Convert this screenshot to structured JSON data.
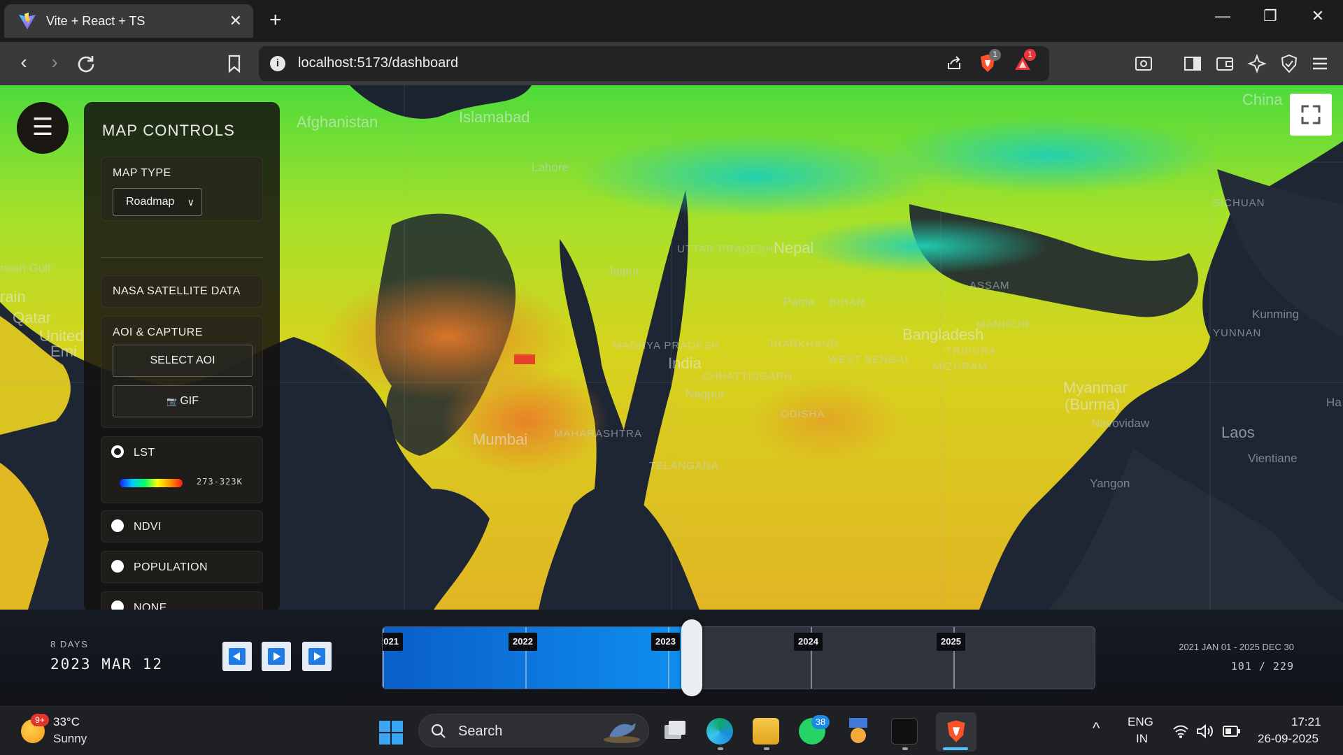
{
  "browser": {
    "tab_title": "Vite + React + TS",
    "close_glyph": "✕",
    "new_tab_glyph": "+",
    "url": "localhost:5173/dashboard",
    "shield_badge": "1",
    "rewards_badge": "1",
    "window": {
      "minimize": "—",
      "restore": "❐",
      "close": "✕"
    }
  },
  "map": {
    "place_labels": [
      "Islamabad",
      "Afghanistan",
      "Lahore",
      "Jaipur",
      "Nepal",
      "Patna",
      "Bangladesh",
      "India",
      "Nagpur",
      "Mumbai",
      "Myanmar",
      "(Burma)",
      "Navovidaw",
      "Yangon",
      "Laos",
      "Vientiane",
      "Kunming",
      "SICHUAN",
      "YUNNAN",
      "China",
      "rsian Gulf",
      "Qatar",
      "United",
      "Emi",
      "rain",
      "Ha",
      "UTTAR PRADESH",
      "MADHYA PRADESH",
      "BIHAR",
      "ASSAM",
      "MAHARASHTRA",
      "TELANGANA",
      "ODISHA",
      "WEST BENGAL",
      "JHARKHAND",
      "CHHATTISGARH",
      "TRIPURA",
      "MIZORAM",
      "MANIPUR"
    ],
    "menu_glyph": "☰"
  },
  "controls": {
    "title": "MAP CONTROLS",
    "map_type_label": "MAP TYPE",
    "map_type_value": "Roadmap",
    "nasa_label": "NASA SATELLITE DATA",
    "aoi_label": "AOI & CAPTURE",
    "select_aoi": "SELECT AOI",
    "gif_label": "GIF",
    "gif_icon": "📷",
    "layers": [
      {
        "label": "LST",
        "checked": true
      },
      {
        "label": "NDVI",
        "checked": false
      },
      {
        "label": "POPULATION",
        "checked": false
      },
      {
        "label": "NONE",
        "checked": false
      }
    ],
    "lst_range": "273-323K"
  },
  "timeline": {
    "interval": "8 DAYS",
    "current_date": "2023 MAR 12",
    "years": [
      "2021",
      "2022",
      "2023",
      "2024",
      "2025"
    ],
    "range": "2021 JAN 01 - 2025 DEC 30",
    "position": "101 / 229",
    "frame_index": 101,
    "frame_total": 229
  },
  "taskbar": {
    "weather_badge": "9+",
    "temperature": "33°C",
    "condition": "Sunny",
    "search_label": "Search",
    "whatsapp_badge": "38",
    "lang_top": "ENG",
    "lang_bottom": "IN",
    "time": "17:21",
    "date": "26-09-2025",
    "chevron": "^"
  },
  "colors": {
    "accent_blue": "#1f7be6",
    "timeline_fill": "#0e8ff0",
    "panel_bg": "#14120f"
  }
}
